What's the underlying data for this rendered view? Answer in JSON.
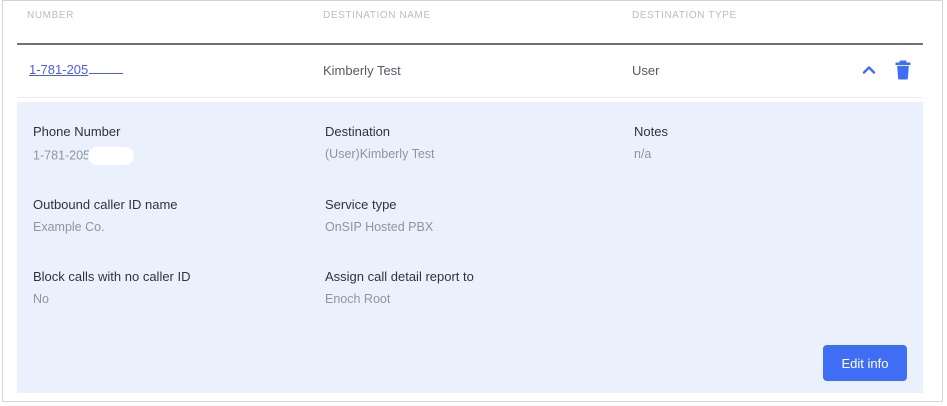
{
  "table": {
    "headers": {
      "number": "NUMBER",
      "destination_name": "DESTINATION NAME",
      "destination_type": "DESTINATION TYPE"
    },
    "row": {
      "number": "1-781-205",
      "destination_name": "Kimberly Test",
      "destination_type": "User"
    }
  },
  "details": {
    "phone_number_label": "Phone Number",
    "phone_number_value": "1-781-205",
    "destination_label": "Destination",
    "destination_value": "(User)Kimberly Test",
    "notes_label": "Notes",
    "notes_value": "n/a",
    "outbound_caller_id_label": "Outbound caller ID name",
    "outbound_caller_id_value": "Example Co.",
    "service_type_label": "Service type",
    "service_type_value": "OnSIP Hosted PBX",
    "block_calls_label": "Block calls with no caller ID",
    "block_calls_value": "No",
    "assign_cdr_label": "Assign call detail report to",
    "assign_cdr_value": "Enoch Root",
    "edit_button_label": "Edit info"
  },
  "colors": {
    "accent": "#3f6df3",
    "link": "#4a5ee6",
    "panel_bg": "#eaf1fd"
  },
  "icons": {
    "collapse": "chevron-up-icon",
    "delete": "trash-icon"
  }
}
